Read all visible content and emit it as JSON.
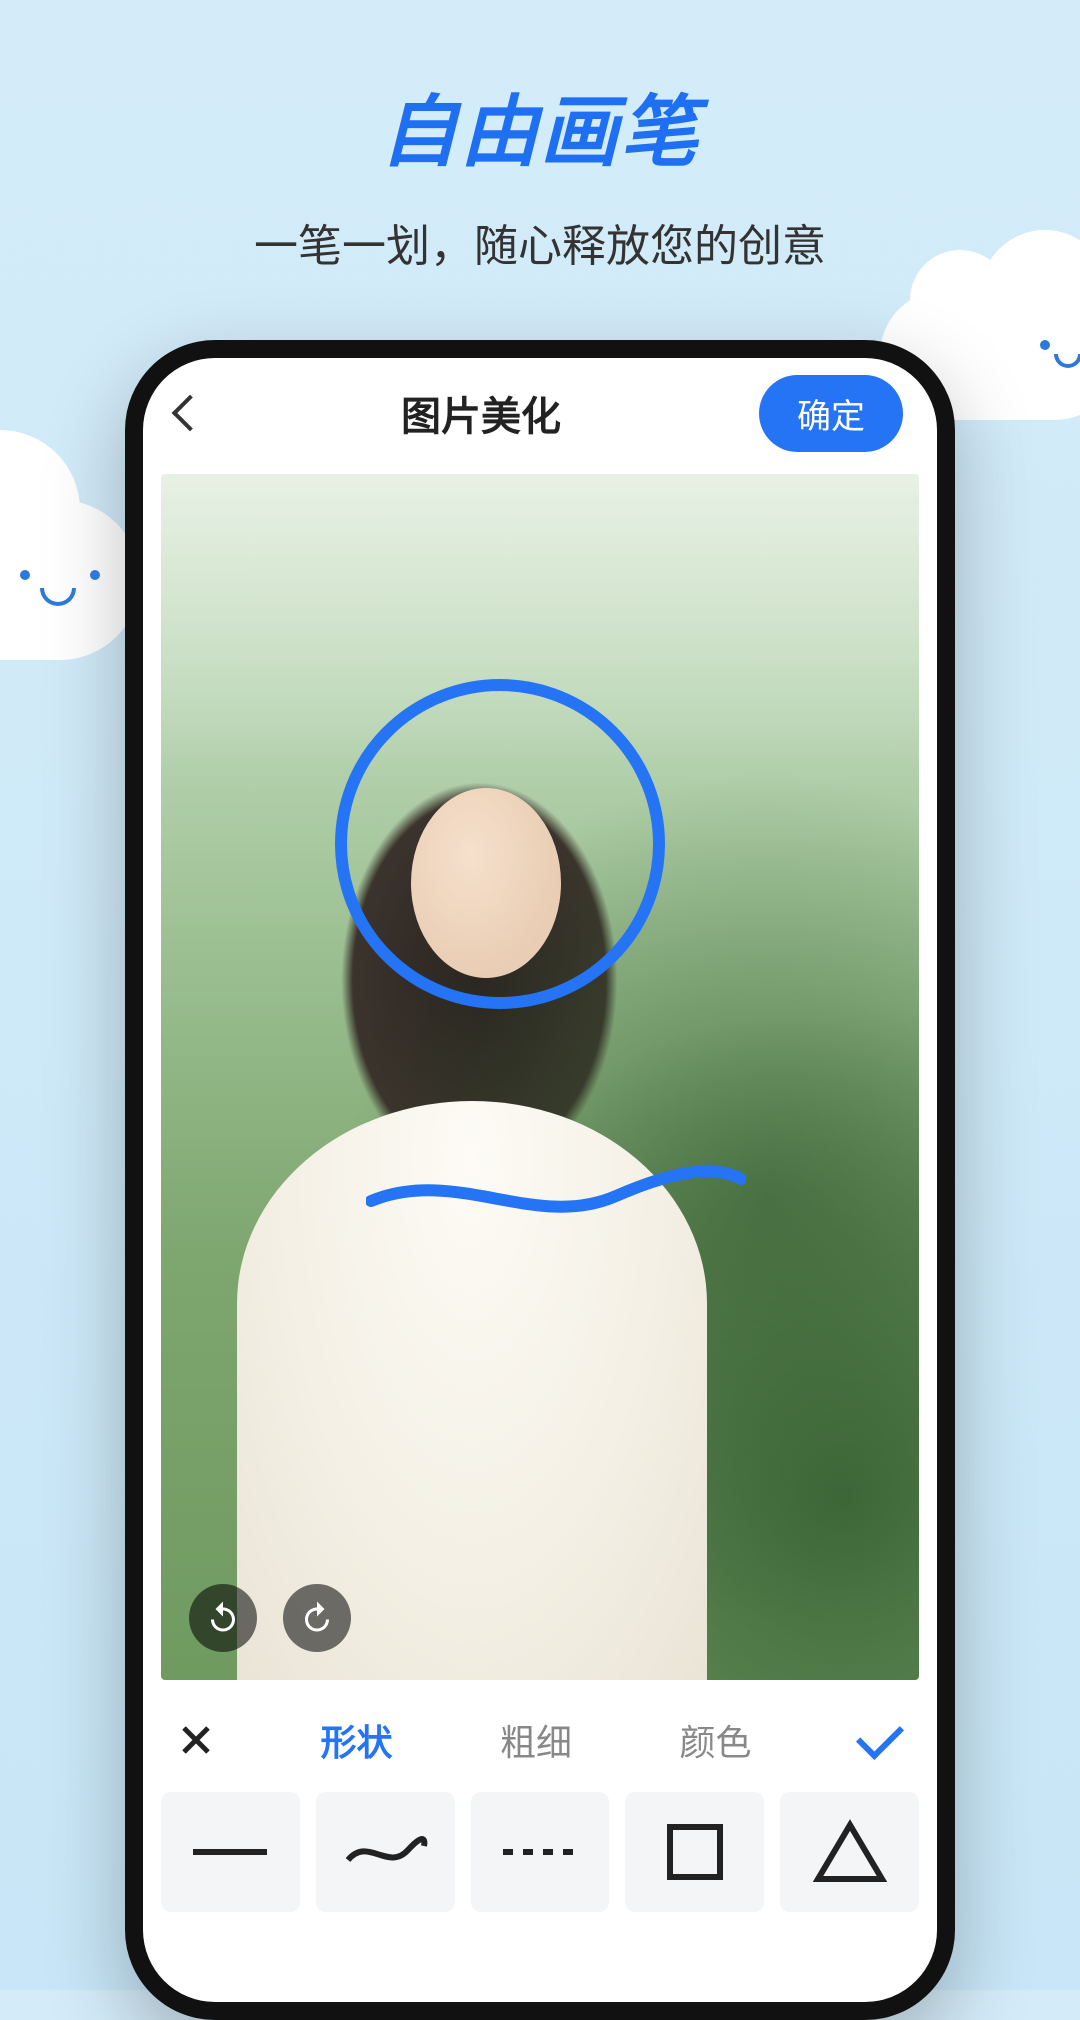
{
  "hero": {
    "title": "自由画笔",
    "subtitle": "一笔一划，随心释放您的创意"
  },
  "topbar": {
    "title": "图片美化",
    "confirm": "确定"
  },
  "tabs": {
    "shape": "形状",
    "thickness": "粗细",
    "color": "颜色"
  },
  "shapes": {
    "line": "line",
    "wave": "wave",
    "dash": "dash",
    "square": "square",
    "triangle": "triangle"
  },
  "colors": {
    "accent": "#2474f5"
  }
}
